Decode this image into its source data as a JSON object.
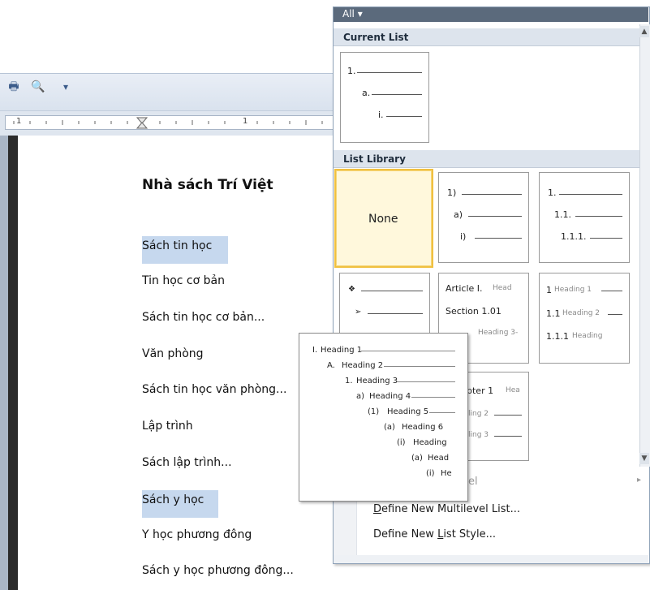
{
  "qat": {
    "dropdown_glyph": "▾"
  },
  "ruler": {
    "marks": [
      "1",
      "1"
    ]
  },
  "document": {
    "title": "Nhà sách Trí Việt",
    "lines": [
      {
        "text": "Sách tin học",
        "highlight": true
      },
      {
        "text": "Tin học cơ bản",
        "highlight": false
      },
      {
        "text": "Sách tin học cơ bản...",
        "highlight": false
      },
      {
        "text": "Văn phòng",
        "highlight": false
      },
      {
        "text": "Sách tin học văn phòng...",
        "highlight": false
      },
      {
        "text": "Lập trình",
        "highlight": false
      },
      {
        "text": "Sách lập trình...",
        "highlight": false
      },
      {
        "text": "Sách y học",
        "highlight": true
      },
      {
        "text": "Y học phương đông",
        "highlight": false
      },
      {
        "text": "Sách y học phương đông...",
        "highlight": false
      }
    ]
  },
  "gallery": {
    "filter_label": "All ▾",
    "current_list_header": "Current List",
    "list_library_header": "List Library",
    "current_list_tile": [
      "1.",
      "a.",
      "i."
    ],
    "none_label": "None",
    "tile_paren": [
      "1)",
      "a)",
      "i)"
    ],
    "tile_decimal": [
      "1.",
      "1.1.",
      "1.1.1."
    ],
    "tile_bullets": [
      "❖",
      "➢"
    ],
    "tile_article": [
      "Article I.",
      "Head",
      "Section 1.01",
      "Heading 3-"
    ],
    "tile_heading_num": [
      "1",
      "Heading 1",
      "1.1",
      "Heading 2",
      "1.1.1",
      "Heading"
    ],
    "tile_chapter": [
      "pter 1",
      "Hea",
      "ling 2",
      "ling 3"
    ],
    "menu": {
      "change_level_partial": "el",
      "define_multilevel": "Define New Multilevel List...",
      "define_multilevel_ul": "D",
      "define_style": "Define New List Style...",
      "define_style_ul": "L"
    }
  },
  "preview": {
    "rows": [
      {
        "num": "I.",
        "label": "Heading 1"
      },
      {
        "num": "A.",
        "label": "Heading 2"
      },
      {
        "num": "1.",
        "label": "Heading 3"
      },
      {
        "num": "a)",
        "label": "Heading 4"
      },
      {
        "num": "(1)",
        "label": "Heading 5"
      },
      {
        "num": "(a)",
        "label": "Heading 6"
      },
      {
        "num": "(i)",
        "label": "Heading"
      },
      {
        "num": "(a)",
        "label": "Head"
      },
      {
        "num": "(i)",
        "label": "He"
      }
    ]
  },
  "colors": {
    "selection_border": "#f0c040",
    "highlight": "#c6d8ee",
    "header_bar": "#5b6a7c"
  }
}
